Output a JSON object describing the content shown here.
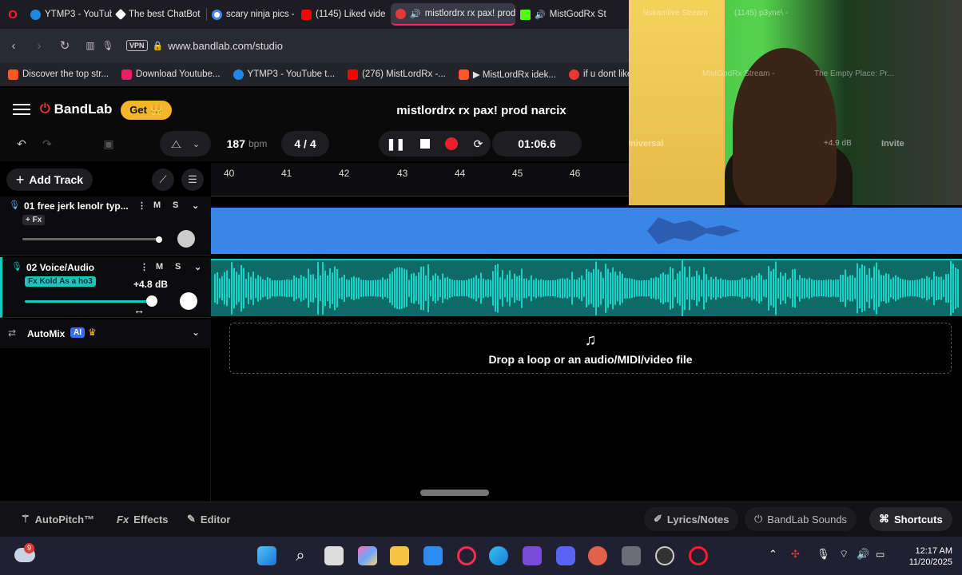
{
  "browser": {
    "tabs": [
      {
        "label": "YTMP3 - YouTube",
        "color": "#1e88e5"
      },
      {
        "label": "The best ChatBot",
        "color": "#ffffff"
      },
      {
        "label": "scary ninja pics -",
        "color": "#4285f4"
      },
      {
        "label": "(1145) Liked vide",
        "color": "#ff0000"
      },
      {
        "label": "mistlordrx rx pax! prod",
        "color": "#e53935"
      },
      {
        "label": "MistGodRx St",
        "color": "#53fc18"
      }
    ],
    "url": "www.bandlab.com/studio",
    "vpn": "VPN",
    "bookmarks": [
      {
        "label": "Discover the top str...",
        "color": "#ff5722"
      },
      {
        "label": "Download Youtube...",
        "color": "#e91e63"
      },
      {
        "label": "YTMP3 - YouTube t...",
        "color": "#1e88e5"
      },
      {
        "label": "(276) MistLordRx -...",
        "color": "#ff0000"
      },
      {
        "label": "▶ MistLordRx idek...",
        "color": "#ff5722"
      },
      {
        "label": "if u dont like it you b...",
        "color": "#e53935"
      }
    ]
  },
  "overlay": {
    "tabs": [
      "lilskamlive Stream",
      "(1145) p3yne\\ -"
    ],
    "bookmarks": [
      "MistGodRx Stream -",
      "The Empty Place: Pr..."
    ],
    "toolbar": [
      "Universal",
      "+4.9 dB",
      "Invite"
    ]
  },
  "bandlab": {
    "brand": "BandLab",
    "get_label": "Get 👑",
    "project_title": "mistlordrx rx pax! prod narcix",
    "bpm": "187",
    "bpm_unit": "bpm",
    "time_sig": "4 / 4",
    "timecode": "01:06.6",
    "add_track": "Add Track",
    "ruler_ticks": [
      "40",
      "41",
      "42",
      "43",
      "44",
      "45",
      "46"
    ],
    "tracks": [
      {
        "name": "01  free jerk lenolr typ...",
        "fx": "+ Fx",
        "mute": "M",
        "solo": "S"
      },
      {
        "name": "02  Voice/Audio",
        "fx": "Fx Kold As a ho3",
        "mute": "M",
        "solo": "S",
        "gain_tooltip": "+4.8 dB"
      }
    ],
    "automix": "AutoMix",
    "automix_badge": "AI",
    "drop_text": "Drop a loop or an audio/MIDI/video file",
    "bottom": {
      "autopitch": "AutoPitch™",
      "effects": "Effects",
      "editor": "Editor",
      "lyrics": "Lyrics/Notes",
      "sounds": "BandLab Sounds",
      "shortcuts": "Shortcuts"
    }
  },
  "taskbar": {
    "time": "12:17 AM",
    "date": "11/20/2025",
    "weather_badge": "9"
  }
}
